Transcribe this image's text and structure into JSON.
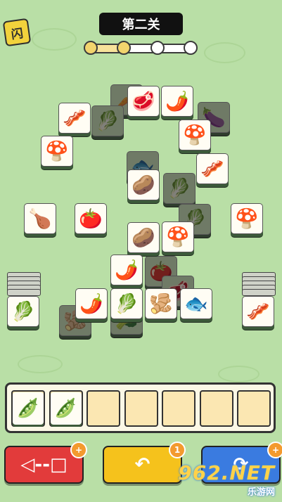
{
  "header": {
    "level_title": "第二关",
    "hint_icon_glyph": "闪",
    "progress": {
      "total_stages": 4,
      "completed_stages": 2,
      "fill_fraction": 0.37
    }
  },
  "board": {
    "tiles": [
      {
        "name": "tile-carrot",
        "icon": "🥕",
        "dim": true
      },
      {
        "name": "tile-meat",
        "icon": "🥩",
        "dim": false
      },
      {
        "name": "tile-chili",
        "icon": "🌶️",
        "dim": false
      },
      {
        "name": "tile-eggplant",
        "icon": "🍆",
        "dim": true
      },
      {
        "name": "tile-bacon",
        "icon": "🥓",
        "dim": false
      },
      {
        "name": "tile-mushroom-shiitake",
        "icon": "🍄",
        "dim": false
      },
      {
        "name": "tile-broccoli",
        "icon": "🥬",
        "dim": true
      },
      {
        "name": "tile-enoki-mushroom",
        "icon": "🍄",
        "dim": false
      },
      {
        "name": "tile-bacon",
        "icon": "🥓",
        "dim": false
      },
      {
        "name": "tile-fish",
        "icon": "🐟",
        "dim": true
      },
      {
        "name": "tile-potato",
        "icon": "🥔",
        "dim": false
      },
      {
        "name": "tile-greens",
        "icon": "🥬",
        "dim": true
      },
      {
        "name": "tile-drumstick",
        "icon": "🍗",
        "dim": false
      },
      {
        "name": "tile-tomato",
        "icon": "🍅",
        "dim": false
      },
      {
        "name": "tile-potato",
        "icon": "🥔",
        "dim": false
      },
      {
        "name": "tile-mushroom-shiitake",
        "icon": "🍄",
        "dim": false
      },
      {
        "name": "tile-bok-choy",
        "icon": "🥬",
        "dim": true
      },
      {
        "name": "tile-enoki-mushroom",
        "icon": "🍄",
        "dim": false
      },
      {
        "name": "tile-chili",
        "icon": "🌶️",
        "dim": false
      },
      {
        "name": "tile-tomato",
        "icon": "🍅",
        "dim": true
      },
      {
        "name": "tile-chili",
        "icon": "🌶️",
        "dim": false
      },
      {
        "name": "tile-bok-choy",
        "icon": "🥬",
        "dim": false
      },
      {
        "name": "tile-ginger",
        "icon": "🫚",
        "dim": false
      },
      {
        "name": "tile-meat",
        "icon": "🥩",
        "dim": true
      },
      {
        "name": "tile-fish",
        "icon": "🐟",
        "dim": false
      },
      {
        "name": "tile-ginger",
        "icon": "🫚",
        "dim": true
      },
      {
        "name": "tile-broccoli",
        "icon": "🥦",
        "dim": true
      }
    ],
    "left_stack": {
      "icon": "🥬",
      "name": "stack-left-bok-choy"
    },
    "right_stack": {
      "icon": "🥓",
      "name": "stack-right-bacon"
    }
  },
  "tray": {
    "slots": [
      "🫛",
      "🫛",
      "",
      "",
      "",
      "",
      ""
    ]
  },
  "actions": {
    "undo_move": {
      "glyph": "◁--□",
      "badge": "+",
      "color": "#e23b3b"
    },
    "undo": {
      "glyph": "↶",
      "badge": "1",
      "color": "#f5c21c"
    },
    "shuffle": {
      "glyph": "⟳",
      "badge": "+",
      "color": "#3a7be0"
    }
  },
  "watermark": {
    "main": "962.NET",
    "sub": "乐游网"
  }
}
